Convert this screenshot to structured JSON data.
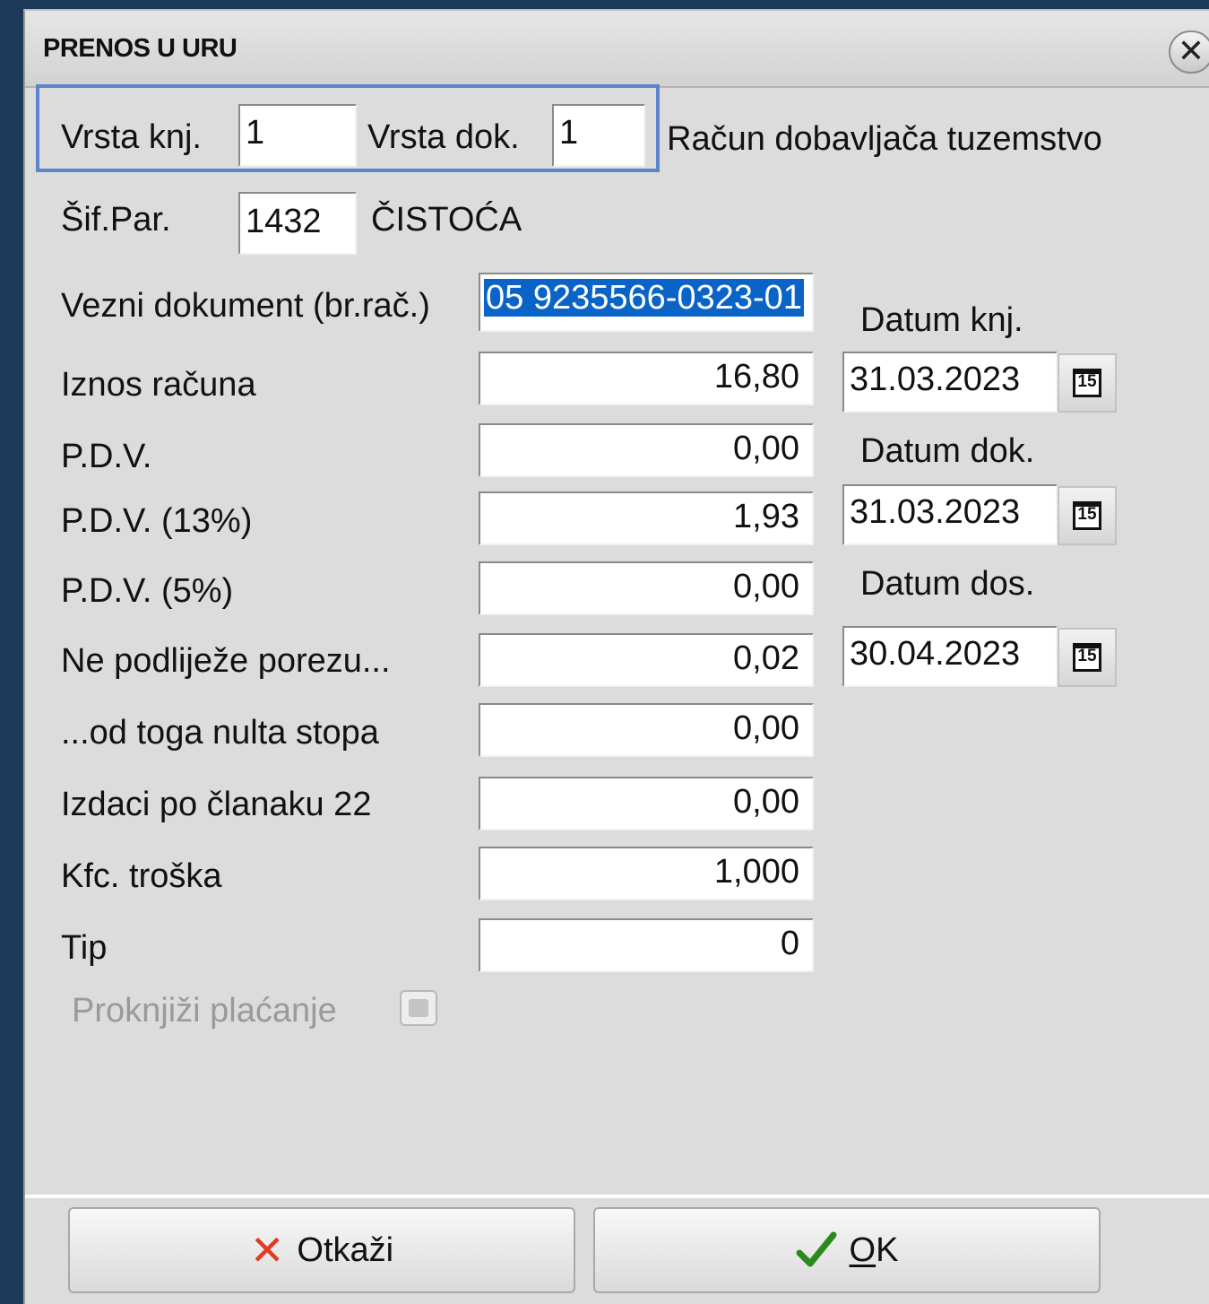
{
  "dialog": {
    "title": "PRENOS U URU",
    "close_glyph": "✕"
  },
  "header": {
    "vrsta_knj_label": "Vrsta knj.",
    "vrsta_knj_value": "1",
    "vrsta_dok_label": "Vrsta dok.",
    "vrsta_dok_value": "1",
    "doc_type_desc": "Račun dobavljača tuzemstvo",
    "sif_par_label": "Šif.Par.",
    "sif_par_value": "1432",
    "partner_name": "ČISTOĆA"
  },
  "form": {
    "vezni_label": "Vezni dokument (br.rač.)",
    "vezni_value": "05 9235566-0323-01",
    "rows": [
      {
        "label": "Iznos računa",
        "value": "16,80"
      },
      {
        "label": "P.D.V.",
        "value": "0,00"
      },
      {
        "label": "P.D.V. (13%)",
        "value": "1,93"
      },
      {
        "label": "P.D.V. (5%)",
        "value": "0,00"
      },
      {
        "label": "Ne podliježe porezu...",
        "value": "0,02"
      },
      {
        "label": "...od toga nulta stopa",
        "value": "0,00"
      },
      {
        "label": "Izdaci po članaku 22",
        "value": "0,00"
      },
      {
        "label": "Kfc. troška",
        "value": "1,000"
      },
      {
        "label": "Tip",
        "value": "0"
      }
    ],
    "proknjizi_label": "Proknjiži plaćanje",
    "proknjizi_checked": false
  },
  "dates": {
    "datum_knj_label": "Datum knj.",
    "datum_knj_value": "31.03.2023",
    "datum_dok_label": "Datum dok.",
    "datum_dok_value": "31.03.2023",
    "datum_dos_label": "Datum dos.",
    "datum_dos_value": "30.04.2023",
    "calendar_glyph": "15"
  },
  "buttons": {
    "cancel_label": "Otkaži",
    "cancel_icon": "✕",
    "ok_label_mnemonic": "O",
    "ok_label_rest": "K"
  },
  "colors": {
    "selection": "#0a64c8",
    "focus_border": "#5e84cc",
    "cancel_icon": "#e03a22",
    "ok_icon": "#2a8a1e"
  }
}
